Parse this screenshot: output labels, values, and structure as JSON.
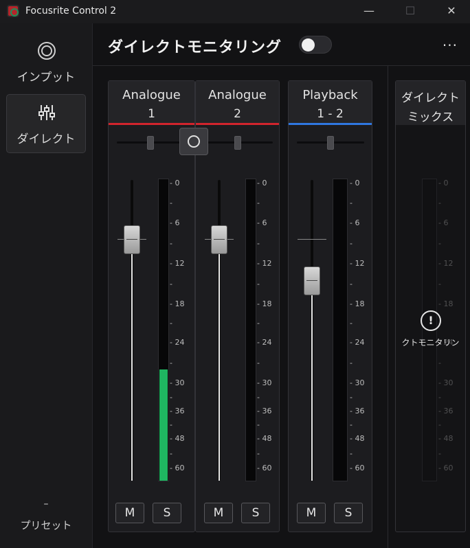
{
  "window": {
    "title": "Focusrite Control 2",
    "minimize": "—",
    "maximize": "☐",
    "close": "✕"
  },
  "sidebar": {
    "items": [
      {
        "label": "インプット",
        "icon": "target-icon",
        "active": false
      },
      {
        "label": "ダイレクト",
        "icon": "sliders-icon",
        "active": true
      }
    ],
    "preset": {
      "dash": "–",
      "label": "プリセット"
    }
  },
  "header": {
    "title": "ダイレクトモニタリング",
    "toggle_on": false,
    "more": "..."
  },
  "scale_ticks": [
    "0",
    "6",
    "12",
    "18",
    "24",
    "30",
    "36",
    "48",
    "60"
  ],
  "channels": [
    {
      "line1": "Analogue",
      "line2": "1",
      "color": "#d1242d",
      "mute": "M",
      "solo": "S",
      "meter_level": 0.37
    },
    {
      "line1": "Analogue",
      "line2": "2",
      "color": "#d1242d",
      "mute": "M",
      "solo": "S",
      "meter_level": 0
    },
    {
      "line1": "Playback",
      "line2": "1 - 2",
      "color": "#2f77e0",
      "mute": "M",
      "solo": "S",
      "meter_level": 0
    }
  ],
  "mix": {
    "line1": "ダイレクト",
    "line2": "ミックス",
    "warning_icon": "!",
    "warning_text": "クトモニタリン"
  }
}
